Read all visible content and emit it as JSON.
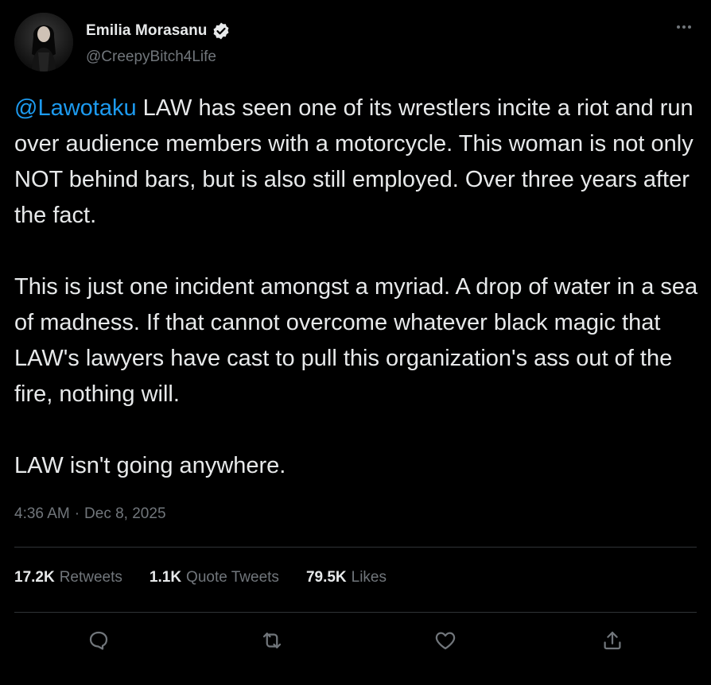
{
  "author": {
    "display_name": "Emilia Morasanu",
    "handle": "@CreepyBitch4Life",
    "verified": true,
    "avatar_icon": "avatar-photo"
  },
  "tweet": {
    "mention": "@Lawotaku",
    "paragraph1_rest": " LAW has seen one of its wrestlers incite a riot and run over audience members with a motorcycle. This woman is not only NOT behind bars, but is also still employed. Over three years after the fact.",
    "paragraph2": "This is just one incident amongst a myriad. A drop of water in a sea of madness. If that cannot overcome whatever black magic that LAW's lawyers have cast to pull this organization's ass out of the fire, nothing will.",
    "paragraph3": "LAW isn't going anywhere."
  },
  "meta": {
    "time": "4:36 AM",
    "separator": "·",
    "date": "Dec 8, 2025"
  },
  "stats": {
    "retweets_count": "17.2K",
    "retweets_label": "Retweets",
    "quotes_count": "1.1K",
    "quotes_label": "Quote Tweets",
    "likes_count": "79.5K",
    "likes_label": "Likes"
  },
  "actions": {
    "reply_icon": "reply-icon",
    "retweet_icon": "retweet-icon",
    "like_icon": "heart-icon",
    "share_icon": "share-icon"
  },
  "colors": {
    "background": "#000000",
    "text": "#e7e9ea",
    "secondary": "#71767b",
    "accent": "#1d9bf0",
    "divider": "#2f3336"
  }
}
